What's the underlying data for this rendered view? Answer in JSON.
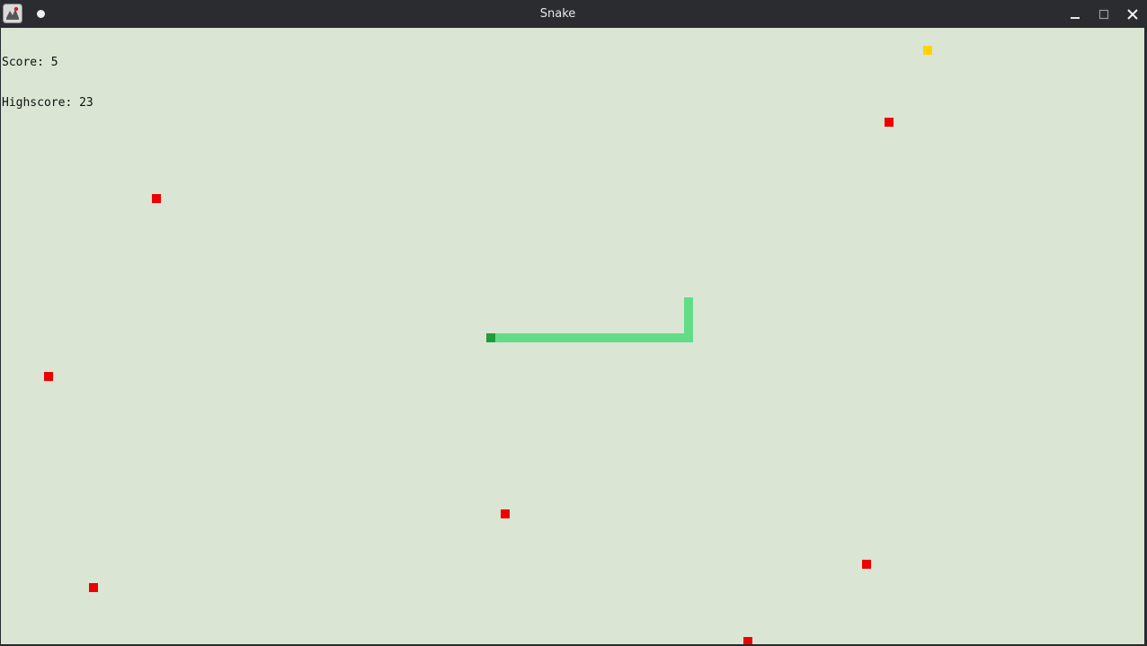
{
  "window": {
    "title": "Snake",
    "icons": {
      "app": "java-app-icon",
      "pin": "pin-dot-icon",
      "minimize": "minimize-icon",
      "maximize": "maximize-icon",
      "close": "close-icon"
    }
  },
  "hud": {
    "score_text": "Score: 5",
    "highscore_text": "Highscore: 23"
  },
  "game": {
    "colors": {
      "background": "#dae5d3",
      "food": "#ee0000",
      "bonus_food": "#ffd400",
      "snake_body": "#62dc86",
      "snake_head": "#239b3c"
    }
  }
}
